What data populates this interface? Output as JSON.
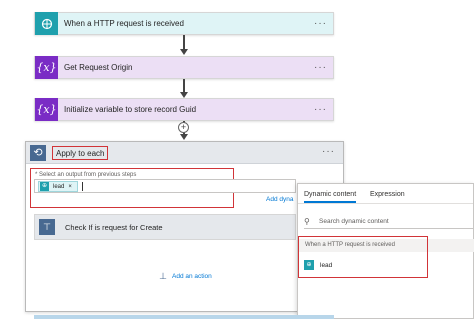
{
  "flow": {
    "trigger": {
      "title": "When a HTTP request is received",
      "more": "···"
    },
    "get_origin": {
      "title": "Get Request Origin",
      "icon_glyph": "{x}",
      "more": "···"
    },
    "init_var": {
      "title": "Initialize variable to store record Guid",
      "icon_glyph": "{x}",
      "more": "···"
    },
    "apply_each": {
      "title": "Apply to each",
      "more": "···",
      "select_label": "* Select an output from previous steps",
      "token_label": "lead",
      "token_remove": "×",
      "add_dynamic_label": "Add dyna",
      "condition_title": "Check If is request for Create",
      "add_action_label": "Add an action"
    }
  },
  "dynamic_panel": {
    "tabs": [
      "Dynamic content",
      "Expression"
    ],
    "search_placeholder": "Search dynamic content",
    "section_label": "When a HTTP request is received",
    "items": [
      {
        "label": "lead"
      }
    ]
  },
  "colors": {
    "trigger_accent": "#1fa0ad",
    "variable_accent": "#7a2cc5",
    "control_accent": "#486991",
    "link": "#0078d4",
    "highlight_red": "#d13438"
  },
  "icons": {
    "trigger": "http-request-icon",
    "variable": "variable-icon",
    "loop": "loop-icon",
    "condition": "condition-icon",
    "search": "search-icon"
  }
}
